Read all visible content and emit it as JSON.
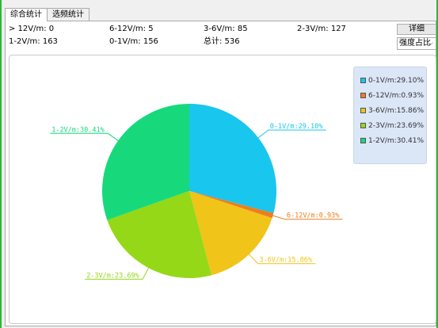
{
  "tabs": [
    {
      "label": "综合统计",
      "active": true
    },
    {
      "label": "选频统计",
      "active": false
    }
  ],
  "stats": {
    "gt12": "> 12V/m: 0",
    "r6_12": "6-12V/m: 5",
    "r3_6": "3-6V/m: 85",
    "r2_3": "2-3V/m: 127",
    "r1_2": "1-2V/m: 163",
    "r0_1": "0-1V/m: 156",
    "total": "总计: 536"
  },
  "controls": {
    "detail_button": "详细",
    "mode_select": "强度占比",
    "mode_arrow": "⌵"
  },
  "chart_data": {
    "type": "pie",
    "title": "",
    "slices": [
      {
        "name": "0-1V/m",
        "value": 29.1,
        "count": 156,
        "color": "#19c6ee",
        "label": "0-1V/m:29.10%"
      },
      {
        "name": "6-12V/m",
        "value": 0.93,
        "count": 5,
        "color": "#ee7d1f",
        "label": "6-12V/m:0.93%"
      },
      {
        "name": "3-6V/m",
        "value": 15.86,
        "count": 85,
        "color": "#f0c418",
        "label": "3-6V/m:15.86%"
      },
      {
        "name": "2-3V/m",
        "value": 23.69,
        "count": 127,
        "color": "#95d817",
        "label": "2-3V/m:23.69%"
      },
      {
        "name": "1-2V/m",
        "value": 30.41,
        "count": 163,
        "color": "#17d97c",
        "label": "1-2V/m:30.41%"
      }
    ],
    "legend": {
      "position": "top-right",
      "entries": [
        "0-1V/m:29.10%",
        "6-12V/m:0.93%",
        "3-6V/m:15.86%",
        "2-3V/m:23.69%",
        "1-2V/m:30.41%"
      ]
    }
  }
}
